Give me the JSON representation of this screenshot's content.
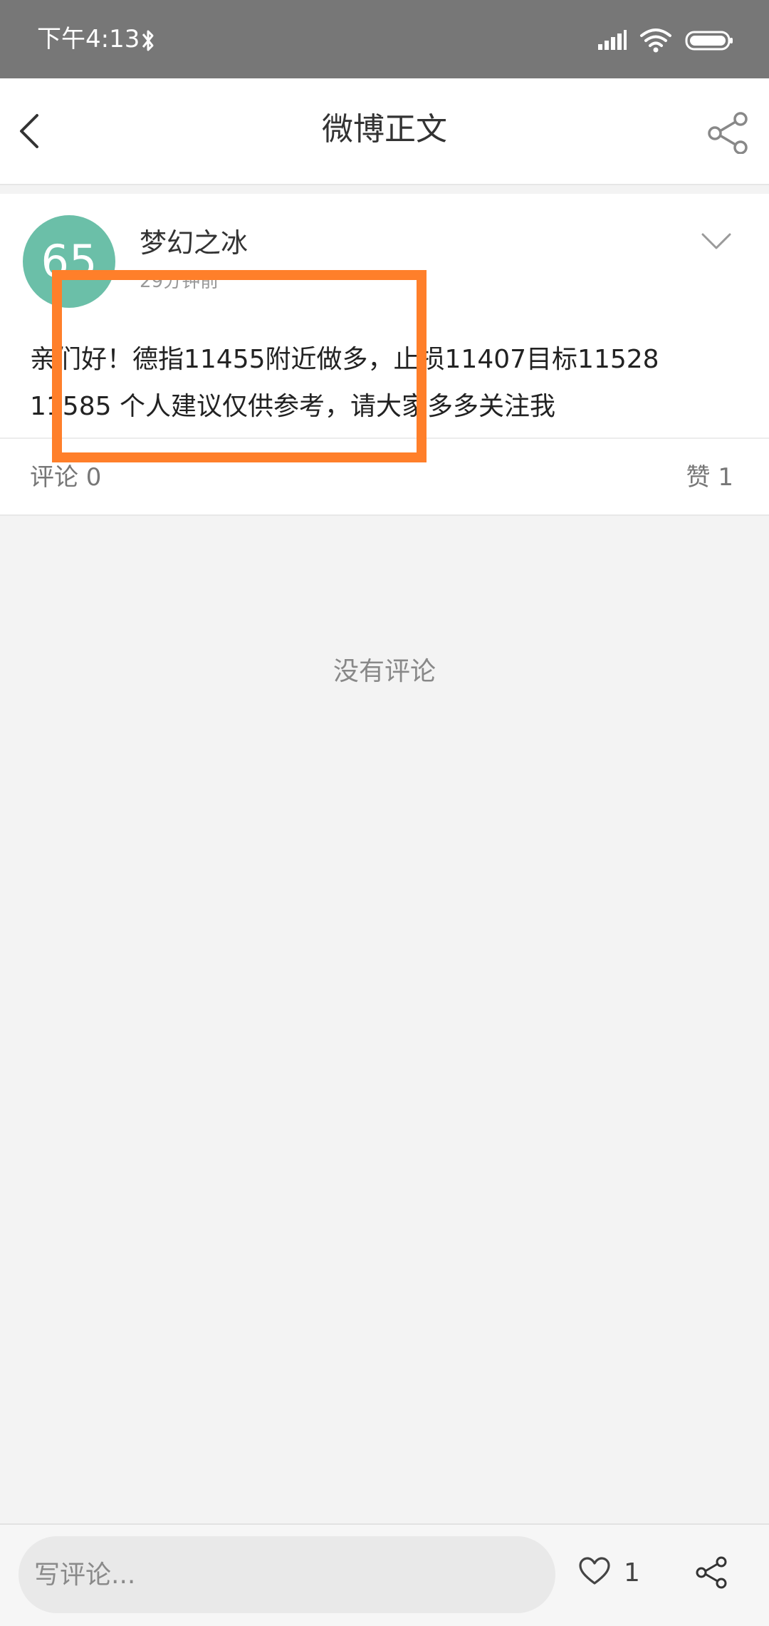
{
  "status_bar": {
    "time": "下午4:13",
    "icons": [
      "bluetooth-icon",
      "signal-icon",
      "wifi-icon",
      "battery-icon"
    ]
  },
  "header": {
    "title": "微博正文",
    "back_icon": "chevron-left-icon",
    "share_icon": "share-icon"
  },
  "post": {
    "avatar_text": "65",
    "avatar_color": "#6bbfa8",
    "author": "梦幻之冰",
    "time": "29分钟前",
    "content": "亲们好！德指11455附近做多，止损11407目标11528 11585  个人建议仅供参考，请大家多多关注我"
  },
  "stats": {
    "comments": "评论 0",
    "likes": "赞 1"
  },
  "comments": {
    "empty_text": "没有评论"
  },
  "footer": {
    "input_placeholder": "写评论...",
    "like_count": "1"
  },
  "colors": {
    "highlight": "#ff7f2a",
    "status_bar": "#777777"
  }
}
